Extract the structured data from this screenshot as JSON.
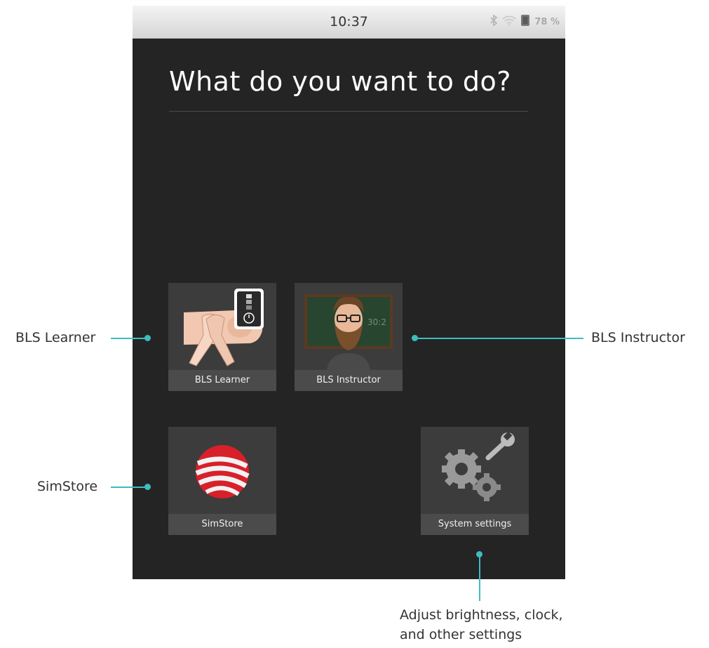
{
  "status_bar": {
    "time": "10:37",
    "battery_percent": "78 %",
    "icons": [
      "bluetooth-icon",
      "wifi-icon",
      "sd-card-icon"
    ]
  },
  "screen": {
    "title": "What do you want to do?"
  },
  "tiles": [
    {
      "label": "BLS Learner",
      "icon": "cpr-hands-icon"
    },
    {
      "label": "BLS Instructor",
      "icon": "instructor-avatar-icon"
    },
    {
      "label": "SimStore",
      "icon": "simstore-logo-icon"
    },
    {
      "label": "System settings",
      "icon": "gears-wrench-icon"
    }
  ],
  "callouts": {
    "bls_learner": "BLS Learner",
    "bls_instructor": "BLS Instructor",
    "simstore": "SimStore",
    "settings_line1": "Adjust brightness, clock,",
    "settings_line2": "and other settings"
  },
  "colors": {
    "accent": "#3ebcc0",
    "screen_bg": "#242424",
    "tile_bg": "#3c3c3c",
    "tile_label_bg": "#4b4b4b",
    "simstore_red": "#d8202a"
  }
}
